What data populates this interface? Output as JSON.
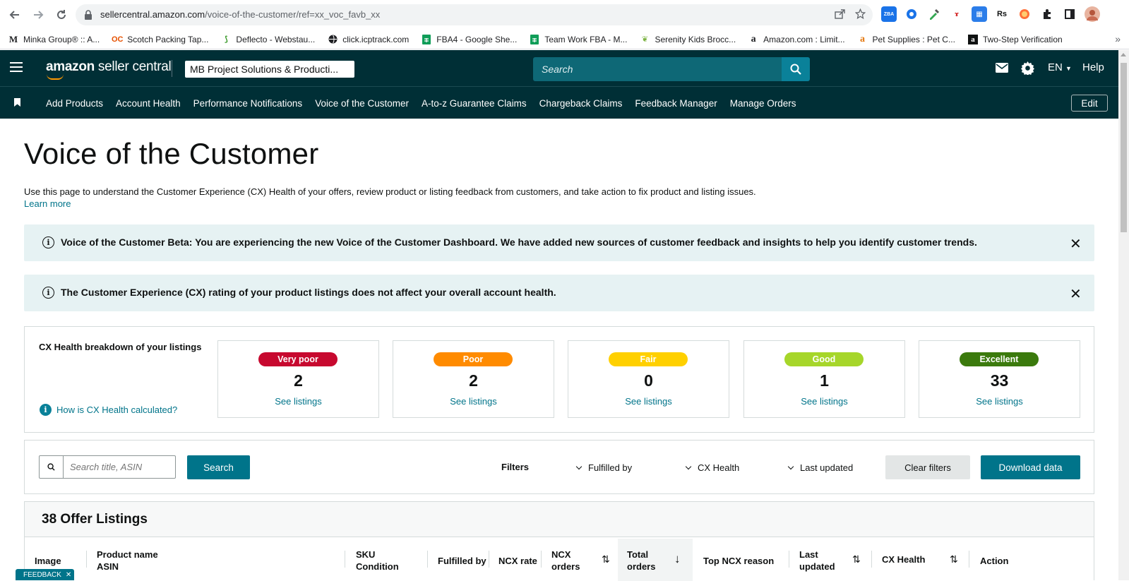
{
  "browser": {
    "url_host": "sellercentral.amazon.com",
    "url_path": "/voice-of-the-customer/ref=xx_voc_favb_xx",
    "bookmarks": [
      {
        "label": "Minka Group® :: A...",
        "icon": "M"
      },
      {
        "label": "Scotch Packing Tap...",
        "icon": "OC"
      },
      {
        "label": "Deflecto - Webstau...",
        "icon": "D"
      },
      {
        "label": "click.icptrack.com",
        "icon": "globe"
      },
      {
        "label": "FBA4 - Google She...",
        "icon": "sheets"
      },
      {
        "label": "Team Work FBA - M...",
        "icon": "sheets"
      },
      {
        "label": "Serenity Kids Brocc...",
        "icon": "leaf"
      },
      {
        "label": "Amazon.com : Limit...",
        "icon": "a"
      },
      {
        "label": "Pet Supplies : Pet C...",
        "icon": "a"
      },
      {
        "label": "Two-Step Verification",
        "icon": "a"
      }
    ]
  },
  "header": {
    "logo_text": "amazon",
    "logo_sub": " seller central",
    "account": "MB Project Solutions & Producti...",
    "search_placeholder": "Search",
    "language": "EN",
    "help": "Help"
  },
  "nav": {
    "items": [
      "Add Products",
      "Account Health",
      "Performance Notifications",
      "Voice of the Customer",
      "A-to-z Guarantee Claims",
      "Chargeback Claims",
      "Feedback Manager",
      "Manage Orders"
    ],
    "edit": "Edit"
  },
  "page": {
    "title": "Voice of the Customer",
    "description": "Use this page to understand the Customer Experience (CX) Health of your offers, review product or listing feedback from customers, and take action to fix product and listing issues.",
    "learn_more": "Learn more"
  },
  "banners": [
    {
      "text": "Voice of the Customer Beta: You are experiencing the new Voice of the Customer Dashboard. We have added new sources of customer feedback and insights to help you identify customer trends."
    },
    {
      "text": "The Customer Experience (CX) rating of your product listings does not affect your overall account health."
    }
  ],
  "cx_health": {
    "title": "CX Health breakdown of your listings",
    "how_link": "How is CX Health calculated?",
    "see_listings": "See listings",
    "cards": [
      {
        "label": "Very poor",
        "count": "2",
        "bg": "#c7092f",
        "fg": "#ffffff"
      },
      {
        "label": "Poor",
        "count": "2",
        "bg": "#ff8b00",
        "fg": "#ffffff"
      },
      {
        "label": "Fair",
        "count": "0",
        "bg": "#ffd000",
        "fg": "#ffffff"
      },
      {
        "label": "Good",
        "count": "1",
        "bg": "#a6d62a",
        "fg": "#ffffff"
      },
      {
        "label": "Excellent",
        "count": "33",
        "bg": "#3b7a0d",
        "fg": "#ffffff"
      }
    ]
  },
  "filters": {
    "search_placeholder": "Search title, ASIN",
    "search_button": "Search",
    "label": "Filters",
    "fulfilled_by": "Fulfilled by",
    "cx_health": "CX Health",
    "last_updated": "Last updated",
    "clear": "Clear filters",
    "download": "Download data"
  },
  "table": {
    "title": "38 Offer Listings",
    "columns": {
      "image": "Image",
      "product_name": "Product name",
      "asin": "ASIN",
      "sku": "SKU",
      "condition": "Condition",
      "fulfilled_by": "Fulfilled by",
      "ncx_rate": "NCX rate",
      "ncx_orders_1": "NCX",
      "ncx_orders_2": "orders",
      "total_orders_1": "Total",
      "total_orders_2": "orders",
      "top_ncx_reason": "Top NCX reason",
      "last_updated_1": "Last",
      "last_updated_2": "updated",
      "cx_health": "CX Health",
      "action": "Action"
    }
  },
  "feedback_tab": "FEEDBACK",
  "colors": {
    "header_bg": "#002f36",
    "accent": "#00748a",
    "banner_bg": "#e6f2f3"
  }
}
